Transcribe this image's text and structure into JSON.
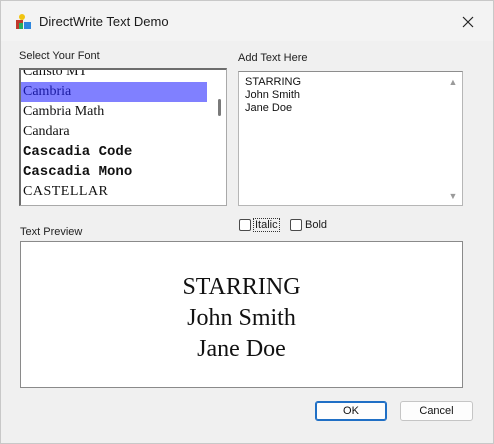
{
  "window": {
    "title": "DirectWrite Text Demo",
    "close_glyph": "✕"
  },
  "font_list": {
    "label": "Select Your Font",
    "items": [
      "Calisto MT",
      "Cambria",
      "Cambria Math",
      "Candara",
      "Cascadia Code",
      "Cascadia Mono",
      "CASTELLAR"
    ],
    "selected": "Cambria"
  },
  "text_input": {
    "label": "Add Text Here",
    "lines": [
      "STARRING",
      "John Smith",
      "Jane Doe"
    ]
  },
  "options": {
    "italic_label": "Italic",
    "italic_checked": false,
    "bold_label": "Bold",
    "bold_checked": false
  },
  "preview": {
    "label": "Text Preview",
    "lines": [
      "STARRING",
      "John Smith",
      "Jane Doe"
    ]
  },
  "buttons": {
    "ok_label": "OK",
    "cancel_label": "Cancel"
  },
  "colors": {
    "selection_bg": "#8080ff",
    "default_button_border": "#1f6fc5"
  },
  "icons": {
    "app": "directwrite-app-icon",
    "close": "close-icon"
  }
}
